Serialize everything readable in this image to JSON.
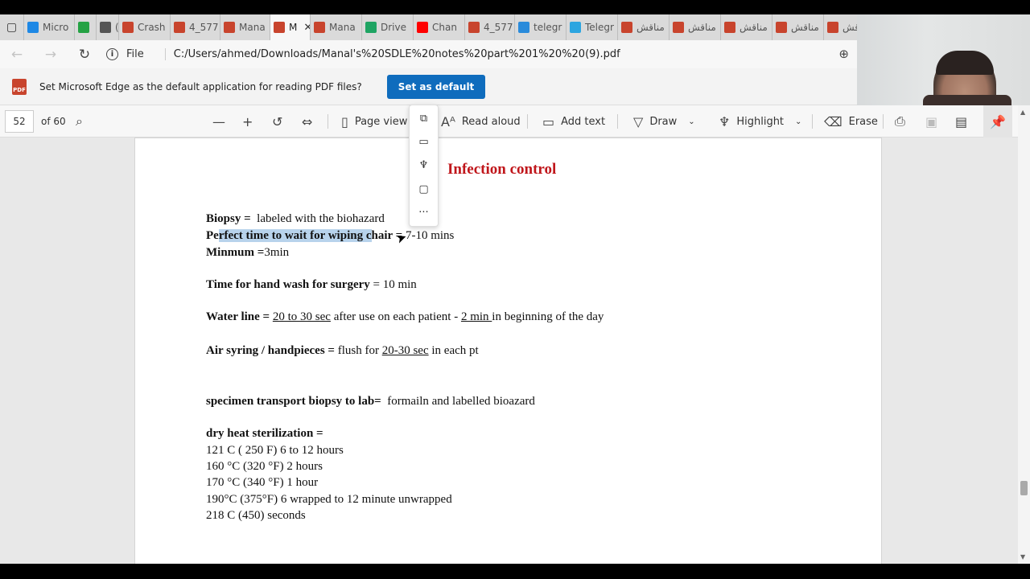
{
  "browser": {
    "tabs": [
      {
        "label": "Micro",
        "icon": "edge-icon",
        "color": "#1e88e5"
      },
      {
        "label": "",
        "icon": "whatsapp-icon",
        "color": "#25a244"
      },
      {
        "label": "(",
        "icon": "speaker-icon",
        "color": "#555555"
      },
      {
        "label": "Crash",
        "icon": "pdf-icon",
        "color": "#c8442d"
      },
      {
        "label": "4_577",
        "icon": "pdf-icon",
        "color": "#c8442d"
      },
      {
        "label": "Mana",
        "icon": "pdf-icon",
        "color": "#c8442d"
      },
      {
        "label": "M",
        "icon": "pdf-icon",
        "color": "#c8442d",
        "active": true
      },
      {
        "label": "Mana",
        "icon": "pdf-icon",
        "color": "#c8442d"
      },
      {
        "label": "Drive",
        "icon": "drive-icon",
        "color": "#1fa463"
      },
      {
        "label": "Chan",
        "icon": "youtube-icon",
        "color": "#ff0000"
      },
      {
        "label": "4_577",
        "icon": "pdf-icon",
        "color": "#c8442d"
      },
      {
        "label": "telegr",
        "icon": "bing-icon",
        "color": "#2a8bdb"
      },
      {
        "label": "Telegr",
        "icon": "telegram-icon",
        "color": "#2ca5e0"
      },
      {
        "label": "مناقش",
        "icon": "pdf-icon",
        "color": "#c8442d"
      },
      {
        "label": "مناقش",
        "icon": "pdf-icon",
        "color": "#c8442d"
      },
      {
        "label": "مناقش",
        "icon": "pdf-icon",
        "color": "#c8442d"
      },
      {
        "label": "مناقش",
        "icon": "pdf-icon",
        "color": "#c8442d"
      },
      {
        "label": "مناقش",
        "icon": "pdf-icon",
        "color": "#c8442d"
      }
    ],
    "site_info_label": "File",
    "url": "C:/Users/ahmed/Downloads/Manal's%20SDLE%20notes%20part%201%20%20(9).pdf"
  },
  "infobar": {
    "message": "Set Microsoft Edge as the default application for reading PDF files?",
    "button_label": "Set as default",
    "pdf_badge": "PDF"
  },
  "pdf_toolbar": {
    "page_number": "52",
    "page_total": "of 60",
    "page_view_label": "Page view",
    "read_aloud_label": "Read aloud",
    "add_text_label": "Add text",
    "draw_label": "Draw",
    "highlight_label": "Highlight",
    "erase_label": "Erase"
  },
  "document": {
    "title": "Infection control",
    "lines": {
      "biopsy_key": "Biopsy =",
      "biopsy_val": "  labeled with the biohazard",
      "wait_key_pre": "Pe",
      "wait_key_hl": "rfect time to wait for wiping c",
      "wait_key_post": "hair =",
      "wait_val": " 7-10 mins",
      "minimum_key": "Minmum =",
      "minimum_val": "3min",
      "handwash_key": "Time for hand wash for surgery",
      "handwash_val": " = 10 min",
      "waterline_key": "Water line =",
      "waterline_u1": "20 to 30 sec",
      "waterline_mid": " after use on each patient - ",
      "waterline_u2": "2 min ",
      "waterline_end": "in beginning of the day",
      "air_key": "Air syring / handpieces =",
      "air_pre": " flush for ",
      "air_u": "20-30 sec",
      "air_end": " in each pt",
      "specimen_key": "specimen transport biopsy to lab=",
      "specimen_val": "  formailn and labelled bioazard",
      "dry_heat_key": "dry heat sterilization =",
      "dry1": "121 C ( 250 F) 6 to 12 hours",
      "dry2": "160 °C (320 °F) 2 hours",
      "dry3": "170 °C (340 °F) 1 hour",
      "dry4": "190°C (375°F) 6 wrapped to 12 minute unwrapped",
      "dry5": "218 C (450) seconds"
    }
  },
  "context_menu": {
    "items": [
      "copy-icon",
      "define-icon",
      "highlight-icon",
      "comment-icon",
      "more-icon"
    ],
    "more_label": "···"
  }
}
